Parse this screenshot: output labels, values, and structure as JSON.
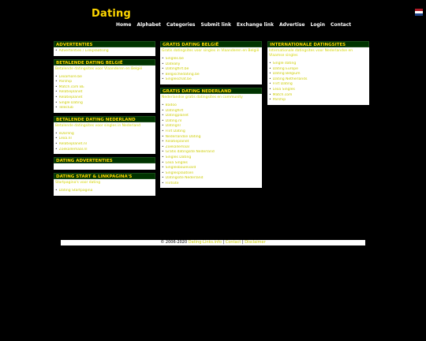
{
  "header": {
    "logo": "Dating",
    "flag_colors": [
      "#ae1c28",
      "#ffffff",
      "#21468b"
    ]
  },
  "nav": [
    "Home",
    "Alphabet",
    "Categories",
    "Submit link",
    "Exchange link",
    "Advertise",
    "Login",
    "Contact"
  ],
  "col1": [
    {
      "title": "ADVERTENTIES",
      "intro": "",
      "items": [
        "Advertenties / Linkplaatsing"
      ]
    },
    {
      "title": "BETALENDE DATING BELGIË",
      "intro": "Betalende datingsites voor Vlaanderen en België",
      "items": [
        "Lexamore.be",
        "Parship",
        "Match.com BE",
        "Relatieplanet",
        "Relatieplanet",
        "Single Dating",
        "Teleclub"
      ]
    },
    {
      "title": "BETALENDE DATING NEDERLAND",
      "intro": "Betalende datingsites voor singles in Nederland",
      "items": [
        "eDarling",
        "Lexa.nl",
        "Relatieplanet.nl",
        "Zoekallemaal.nl"
      ]
    },
    {
      "title": "DATING ADVERTENTIES",
      "intro": "",
      "items": []
    },
    {
      "title": "DATING START & LINKPAGINA'S",
      "intro": "Startpagina's voor dating",
      "items": [
        "Dating Startpagina"
      ]
    }
  ],
  "col2": [
    {
      "title": "GRATIS DATING BELGIË",
      "intro": "Gratis datingsites voor singles in Vlaanderen en België",
      "items": [
        "Singles.be",
        "Dateally",
        "Datingflirt.be",
        "Belgischedating.be",
        "Singleschat.be"
      ]
    },
    {
      "title": "GRATIS DATING NEDERLAND",
      "intro": "Nederlandse gratis datingsites en community",
      "items": [
        "Badoo",
        "Datingflirt",
        "Datingplanet",
        "Dating.nl",
        "Datingnl",
        "Flirt Dating",
        "Nederlandse Dating",
        "Relatieplanet",
        "Zoekallemaal",
        "Gratis datingsite Nederland",
        "Singles Dating",
        "Lexa Singles",
        "Singlesboulevard",
        "Singlesplaatsen",
        "Datingsite Nederland",
        "Flirtsite"
      ]
    }
  ],
  "col3": [
    {
      "title": "INTERNATIONALE DATINGSITES",
      "intro": "Internationale datingsites voor Nederlandse en Vlaamse singles",
      "items": [
        "Single dating",
        "Dating Europe",
        "Dating Belgium",
        "Dating Netherlands",
        "Flirt Dating",
        "Lexa Singles",
        "Match.com",
        "Parship"
      ]
    }
  ],
  "footer": {
    "copyright": "© 2006-2020",
    "links": [
      "Dating-Links.info",
      "Contact",
      "Disclaimer"
    ]
  }
}
